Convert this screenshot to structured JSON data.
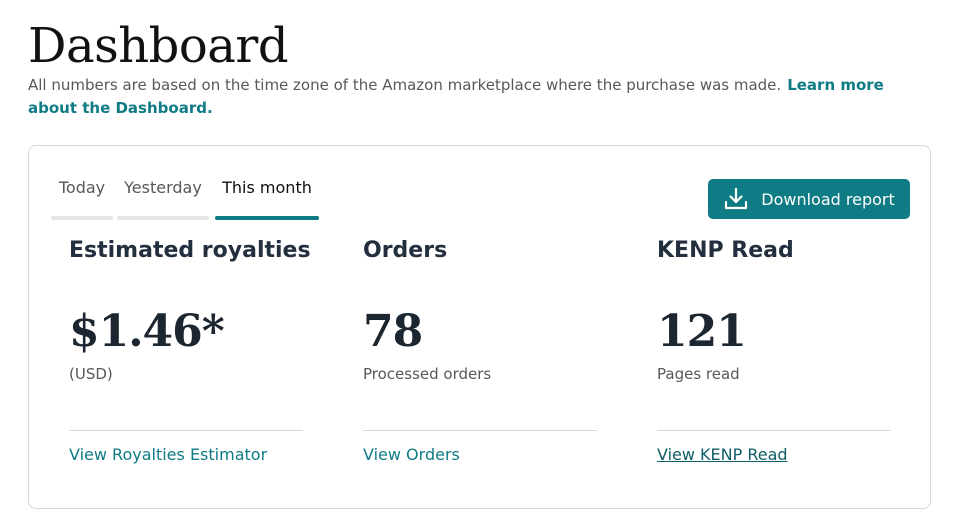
{
  "header": {
    "title": "Dashboard",
    "subtitle": "All numbers are based on the time zone of the Amazon marketplace where the purchase was made.",
    "learn_more_link": "Learn more about the Dashboard."
  },
  "tabs": [
    {
      "label": "Today",
      "active": false
    },
    {
      "label": "Yesterday",
      "active": false
    },
    {
      "label": "This month",
      "active": true
    }
  ],
  "toolbar": {
    "download_label": "Download report",
    "download_icon": "download-icon"
  },
  "metrics": {
    "royalties": {
      "title": "Estimated royalties",
      "value": "$1.46*",
      "caption": "(USD)",
      "link": "View Royalties Estimator"
    },
    "orders": {
      "title": "Orders",
      "value": "78",
      "caption": "Processed orders",
      "link": "View Orders"
    },
    "kenp": {
      "title": "KENP Read",
      "value": "121",
      "caption": "Pages read",
      "link": "View KENP Read"
    }
  },
  "colors": {
    "accent": "#0f7b84",
    "text_dark": "#232f3e",
    "text_muted": "#565959",
    "border": "#d5d9d9"
  }
}
